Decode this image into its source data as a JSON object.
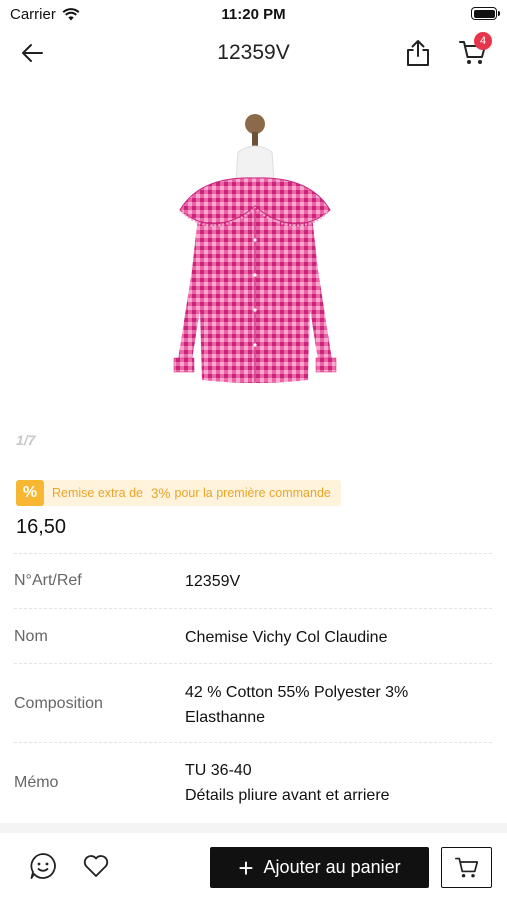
{
  "status_bar": {
    "carrier": "Carrier",
    "time": "11:20 PM"
  },
  "nav": {
    "title": "12359V",
    "cart_count": "4"
  },
  "gallery": {
    "counter": "1/7",
    "icons": {
      "back": "arrow-left-icon",
      "share": "share-icon",
      "cart": "cart-icon"
    }
  },
  "promo": {
    "label": "Remise extra de",
    "highlight": "3%",
    "suffix": "pour la première commande"
  },
  "product": {
    "price": "16,50",
    "details": [
      {
        "label": "N°Art/Ref",
        "value": "12359V"
      },
      {
        "label": "Nom",
        "value": "Chemise Vichy Col Claudine"
      },
      {
        "label": "Composition",
        "value_lines": [
          "42 % Cotton 55% Polyester 3%",
          "Elasthanne"
        ]
      },
      {
        "label": "Mémo",
        "value_lines": [
          "TU 36-40",
          "Détails pliure avant et arriere"
        ]
      }
    ]
  },
  "bottom_bar": {
    "add_to_cart": "Ajouter au panier"
  },
  "colors": {
    "accent": "#111111",
    "badge": "#e8344a",
    "promo_bg": "#fff3dc",
    "promo_text": "#e8a52a",
    "shirt_pink": "#e84d96"
  }
}
